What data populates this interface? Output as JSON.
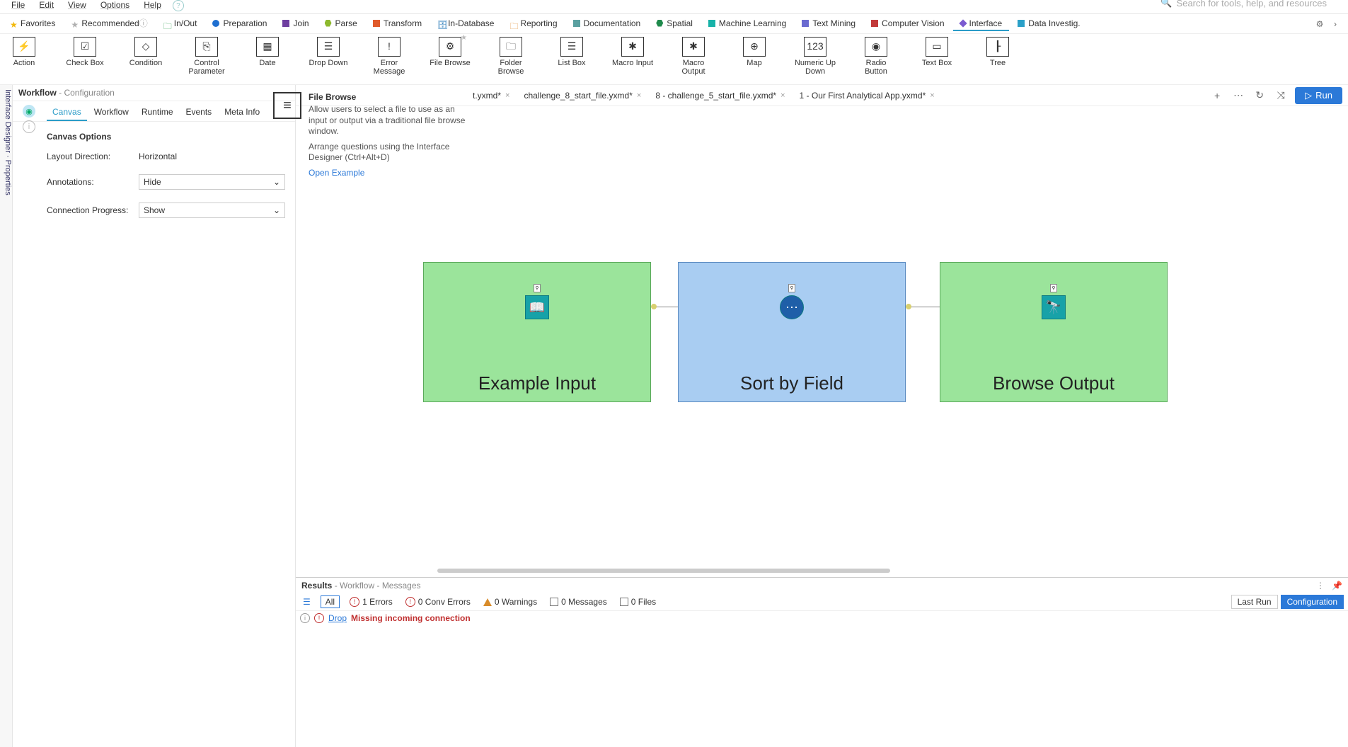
{
  "menu": {
    "file": "File",
    "edit": "Edit",
    "view": "View",
    "options": "Options",
    "help": "Help"
  },
  "search_placeholder": "Search for tools, help, and resources",
  "categories": [
    {
      "label": "Favorites",
      "color": "#f2b90c",
      "shape": "star"
    },
    {
      "label": "Recommended",
      "color": "#b0b0b0",
      "shape": "star",
      "info": true
    },
    {
      "label": "In/Out",
      "color": "#2e9e4f",
      "shape": "folder"
    },
    {
      "label": "Preparation",
      "color": "#1f6fd0",
      "shape": "circle"
    },
    {
      "label": "Join",
      "color": "#6f3fa0",
      "shape": "square"
    },
    {
      "label": "Parse",
      "color": "#8db92e",
      "shape": "hex"
    },
    {
      "label": "Transform",
      "color": "#e05a2b",
      "shape": "square"
    },
    {
      "label": "In-Database",
      "color": "#2a7bb8",
      "shape": "db"
    },
    {
      "label": "Reporting",
      "color": "#e08a2b",
      "shape": "folder"
    },
    {
      "label": "Documentation",
      "color": "#5aa0a0",
      "shape": "square"
    },
    {
      "label": "Spatial",
      "color": "#1f8a4c",
      "shape": "hex"
    },
    {
      "label": "Machine Learning",
      "color": "#17b2a8",
      "shape": "square"
    },
    {
      "label": "Text Mining",
      "color": "#6a6ad0",
      "shape": "square"
    },
    {
      "label": "Computer Vision",
      "color": "#c23a3a",
      "shape": "square"
    },
    {
      "label": "Interface",
      "color": "#7a5ad0",
      "shape": "diamond",
      "active": true
    },
    {
      "label": "Data Investig.",
      "color": "#2aa0c8",
      "shape": "square"
    }
  ],
  "tools": [
    {
      "label": "Action",
      "glyph": "⚡"
    },
    {
      "label": "Check Box",
      "glyph": "☑"
    },
    {
      "label": "Condition",
      "glyph": "◇"
    },
    {
      "label": "Control Parameter",
      "glyph": "⎘"
    },
    {
      "label": "Date",
      "glyph": "▦"
    },
    {
      "label": "Drop Down",
      "glyph": "☰"
    },
    {
      "label": "Error Message",
      "glyph": "!"
    },
    {
      "label": "File Browse",
      "glyph": "⚙",
      "star": true
    },
    {
      "label": "Folder Browse",
      "glyph": "🗀"
    },
    {
      "label": "List Box",
      "glyph": "☰"
    },
    {
      "label": "Macro Input",
      "glyph": "✱"
    },
    {
      "label": "Macro Output",
      "glyph": "✱"
    },
    {
      "label": "Map",
      "glyph": "⊕"
    },
    {
      "label": "Numeric Up Down",
      "glyph": "123"
    },
    {
      "label": "Radio Button",
      "glyph": "◉"
    },
    {
      "label": "Text Box",
      "glyph": "▭"
    },
    {
      "label": "Tree",
      "glyph": "┠"
    }
  ],
  "config": {
    "panel_title": "Workflow",
    "panel_sub": "Configuration",
    "tabs": [
      "Canvas",
      "Workflow",
      "Runtime",
      "Events",
      "Meta Info"
    ],
    "active_tab": "Canvas",
    "section": "Canvas Options",
    "rows": {
      "layout_label": "Layout Direction:",
      "layout_value": "Horizontal",
      "annotations_label": "Annotations:",
      "annotations_value": "Hide",
      "connprog_label": "Connection Progress:",
      "connprog_value": "Show"
    }
  },
  "sidestrip": "Interface Designer ·  Properties",
  "info": {
    "title": "File Browse",
    "desc1": "Allow users to select a file to use as an input or output via a traditional file browse window.",
    "desc2": "Arrange questions using the Interface Designer (Ctrl+Alt+D)",
    "link": "Open Example"
  },
  "doctabs": [
    {
      "label": "t.yxmd*"
    },
    {
      "label": "challenge_8_start_file.yxmd*"
    },
    {
      "label": "8 - challenge_5_start_file.yxmd*"
    },
    {
      "label": "1 - Our First Analytical App.yxmd*"
    }
  ],
  "run_label": "Run",
  "nodes": {
    "n1": "Example Input",
    "n2": "Sort by Field",
    "n3": "Browse Output"
  },
  "results": {
    "title": "Results",
    "sub": "Workflow - Messages",
    "filters": {
      "all": "All",
      "errors": "1 Errors",
      "conv": "0 Conv Errors",
      "warn": "0 Warnings",
      "msgs": "0 Messages",
      "files": "0 Files"
    },
    "segments": {
      "last": "Last Run",
      "cfg": "Configuration"
    },
    "msg_link": "Drop",
    "msg_err": "Missing incoming connection"
  }
}
